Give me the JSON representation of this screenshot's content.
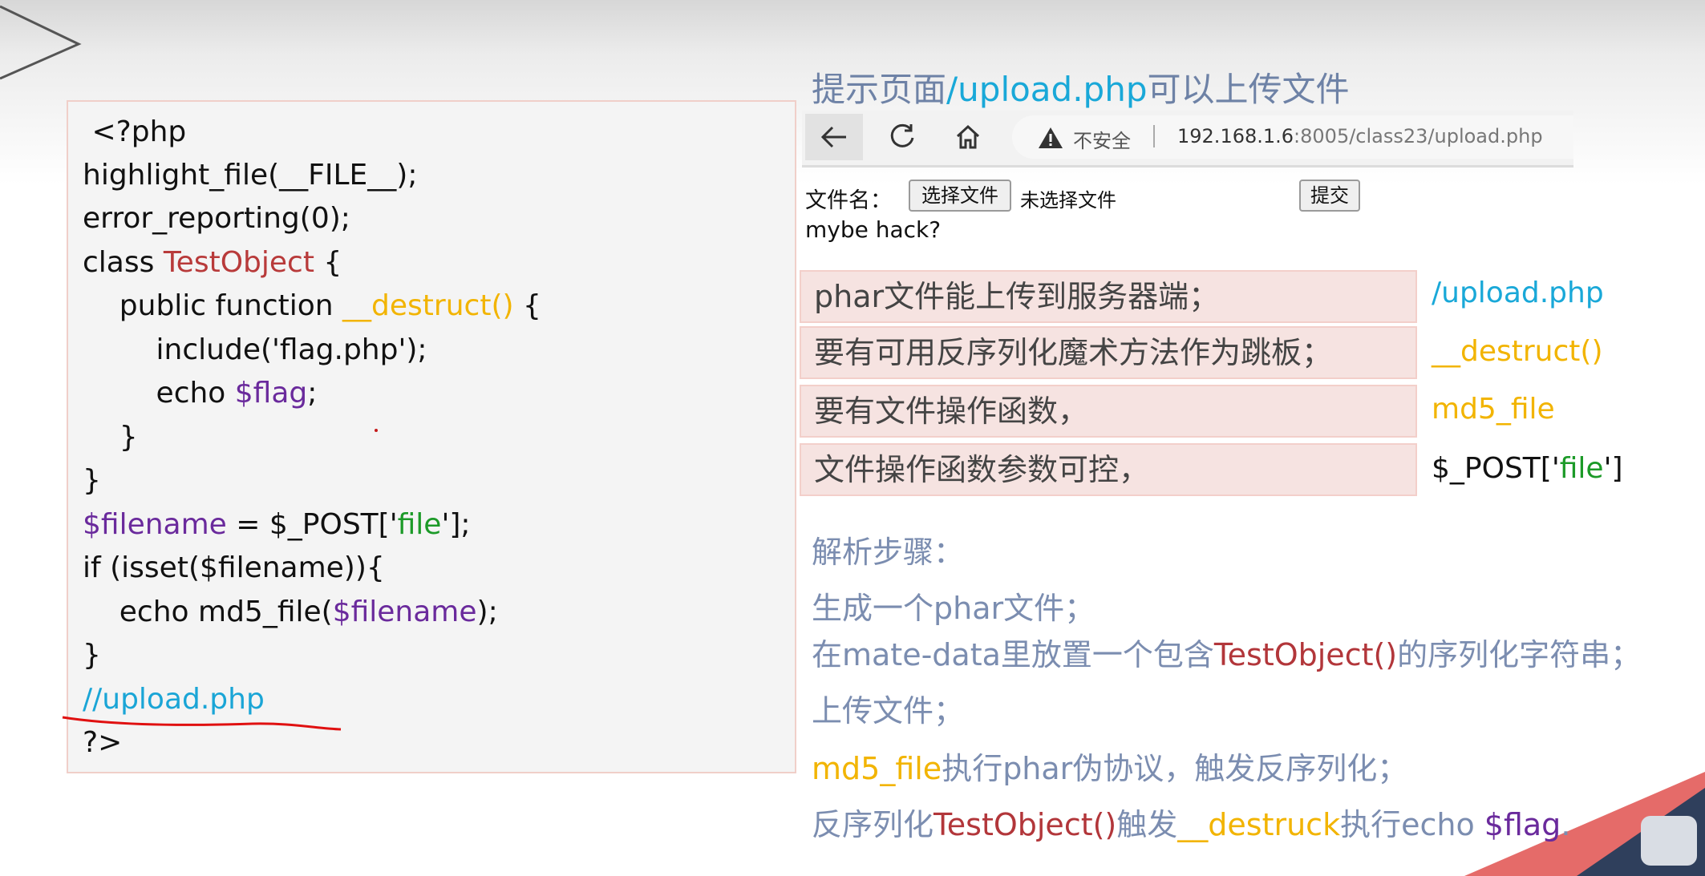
{
  "code": {
    "lines": [
      " <?php",
      "highlight_file(__FILE__);",
      "error_reporting(0);",
      "class ",
      "TestObject",
      " {",
      "    public function ",
      "__destruct()",
      " {",
      "        include('flag.php');",
      "        echo ",
      "$flag",
      ";",
      "    }",
      "}",
      "$filename",
      " = $_POST['",
      "file",
      "'];",
      "if (isset($filename)){",
      "    echo md5_file(",
      "$filename",
      ");",
      "}",
      "//upload.php",
      "?>"
    ]
  },
  "hint": {
    "prefix": "提示页面",
    "path": "/upload.php",
    "suffix": "可以上传文件"
  },
  "browser": {
    "insecure_label": "不安全",
    "url_host": "192.168.1.6",
    "url_rest": ":8005/class23/upload.php"
  },
  "form": {
    "filename_label": "文件名：",
    "choose_file": "选择文件",
    "no_file": "未选择文件",
    "submit": "提交",
    "response": "mybe hack?"
  },
  "requirements": [
    {
      "label": "phar文件能上传到服务器端；",
      "value": "/upload.php",
      "color": "#19a8d8"
    },
    {
      "label": "要有可用反序列化魔术方法作为跳板；",
      "value": "__destruct()",
      "color": "#f2b400"
    },
    {
      "label": "要有文件操作函数，",
      "value": "md5_file",
      "color": "#f2b400"
    },
    {
      "label": "文件操作函数参数可控，",
      "value_prefix": "$_POST['",
      "value_mid": "file",
      "value_suffix": "']",
      "color": "#111111"
    }
  ],
  "steps": {
    "title": "解析步骤：",
    "s1": "生成一个phar文件；",
    "s2_a": "在mate-data里放置一个包含",
    "s2_b": "TestObject()",
    "s2_c": "的序列化字符串；",
    "s3": "上传文件；",
    "s4_a": "md5_file",
    "s4_b": "执行phar伪协议，触发反序列化；",
    "s5_a": "反序列化",
    "s5_b": "TestObject()",
    "s5_c": "触发",
    "s5_d": "__destruck",
    "s5_e": "执行echo ",
    "s5_f": "$flag",
    "s5_g": "."
  }
}
